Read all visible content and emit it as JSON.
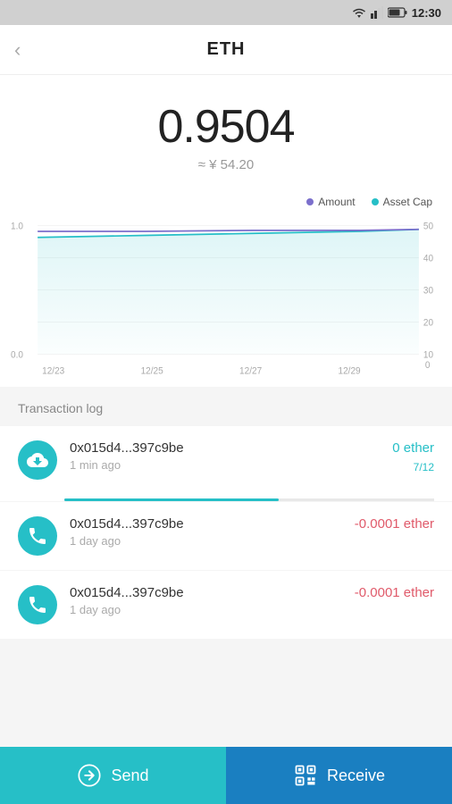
{
  "statusBar": {
    "time": "12:30"
  },
  "header": {
    "back": "‹",
    "title": "ETH"
  },
  "balance": {
    "amount": "0.9504",
    "fiat": "≈ ¥ 54.20"
  },
  "chart": {
    "legend": {
      "amount_label": "Amount",
      "asset_cap_label": "Asset Cap",
      "amount_color": "#7b6fcc",
      "asset_cap_color": "#26bfc7"
    },
    "x_labels": [
      "12/23",
      "12/25",
      "12/27",
      "12/29"
    ],
    "y_left_labels": [
      "1.0",
      "0.0"
    ],
    "y_right_labels": [
      "50",
      "40",
      "30",
      "20",
      "10",
      "0"
    ]
  },
  "txLog": {
    "title": "Transaction log",
    "items": [
      {
        "address": "0x015d4...397c9be",
        "time": "1 min ago",
        "amount": "0 ether",
        "amount_type": "positive",
        "progress": "7/12",
        "progress_pct": 58
      },
      {
        "address": "0x015d4...397c9be",
        "time": "1 day ago",
        "amount": "-0.0001 ether",
        "amount_type": "negative",
        "progress": null,
        "progress_pct": null
      },
      {
        "address": "0x015d4...397c9be",
        "time": "1 day ago",
        "amount": "-0.0001 ether",
        "amount_type": "negative",
        "progress": null,
        "progress_pct": null
      }
    ]
  },
  "bottomBar": {
    "send_label": "Send",
    "receive_label": "Receive"
  }
}
